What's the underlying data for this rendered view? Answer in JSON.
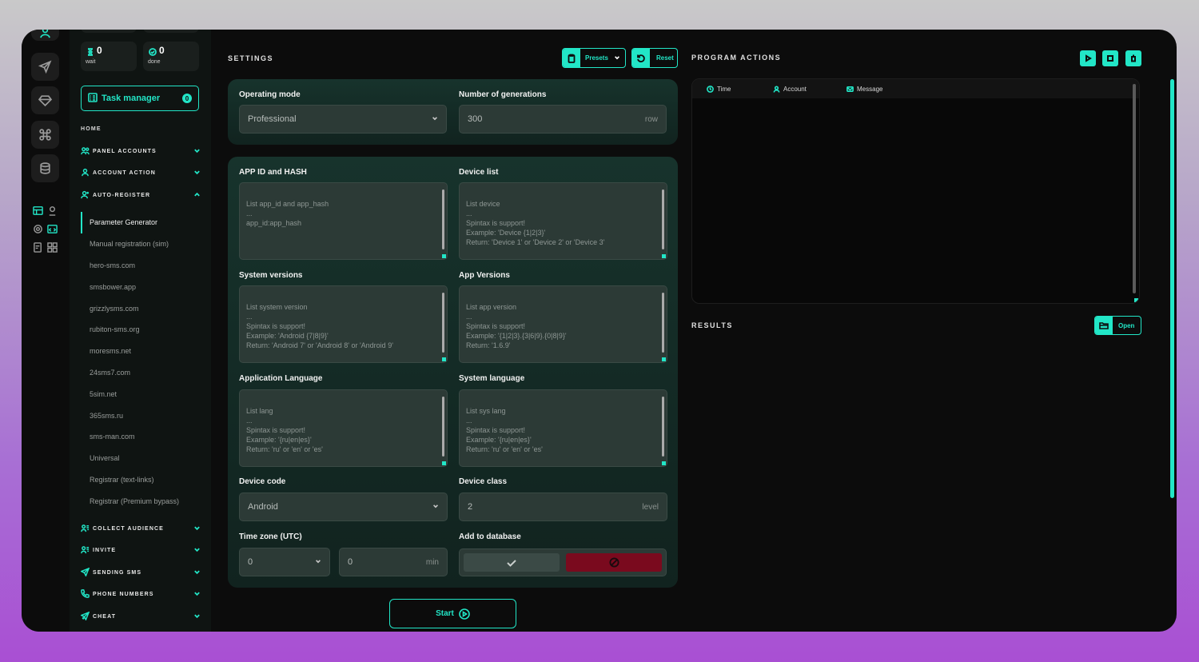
{
  "counters": [
    {
      "value": "0",
      "label": "wait",
      "icon": "hourglass-icon"
    },
    {
      "value": "0",
      "label": "done",
      "icon": "check-circle-icon"
    }
  ],
  "task_manager": {
    "label": "Task manager",
    "badge": "0"
  },
  "sidebar": {
    "home": "HOME",
    "sections_top": [
      {
        "label": "PANEL ACCOUNTS",
        "icon": "users-icon"
      },
      {
        "label": "ACCOUNT ACTION",
        "icon": "user-icon"
      },
      {
        "label": "AUTO-REGISTER",
        "icon": "user-plus-icon"
      }
    ],
    "sub_items": [
      "Parameter Generator",
      "Manual registration (sim)",
      "hero-sms.com",
      "smsbower.app",
      "grizzlysms.com",
      "rubiton-sms.org",
      "moresms.net",
      "24sms7.com",
      "5sim.net",
      "365sms.ru",
      "sms-man.com",
      "Universal",
      "Registrar (text-links)",
      "Registrar (Premium bypass)"
    ],
    "sections_bottom": [
      {
        "label": "COLLECT AUDIENCE",
        "icon": "user-list-icon"
      },
      {
        "label": "INVITE",
        "icon": "user-list-icon"
      },
      {
        "label": "SENDING SMS",
        "icon": "send-icon"
      },
      {
        "label": "PHONE NUMBERS",
        "icon": "phone-icon"
      },
      {
        "label": "CHEAT",
        "icon": "send-plus-icon"
      }
    ]
  },
  "settings": {
    "title": "SETTINGS",
    "presets_label": "Presets",
    "reset_label": "Reset",
    "operating_mode": {
      "label": "Operating mode",
      "value": "Professional"
    },
    "generations": {
      "label": "Number of generations",
      "value": "300",
      "unit": "row"
    },
    "app_id": {
      "label": "APP ID and HASH",
      "placeholder": "List app_id and app_hash\n...\napp_id:app_hash"
    },
    "device_list": {
      "label": "Device list",
      "placeholder": "List device\n...\nSpintax is support!\nExample: 'Device {1|2|3}'\nReturn: 'Device 1' or 'Device 2' or 'Device 3'"
    },
    "system_versions": {
      "label": "System versions",
      "placeholder": "List system version\n...\nSpintax is support!\nExample: 'Android {7|8|9}'\nReturn: 'Android 7' or 'Android 8' or 'Android 9'"
    },
    "app_versions": {
      "label": "App Versions",
      "placeholder": "List app version\n...\nSpintax is support!\nExample: '{1|2|3}.{3|6|9}.{0|8|9}'\nReturn: '1.6.9'"
    },
    "app_language": {
      "label": "Application Language",
      "placeholder": "List lang\n...\nSpintax is support!\nExample: '{ru|en|es}'\nReturn: 'ru' or 'en' or 'es'"
    },
    "system_language": {
      "label": "System language",
      "placeholder": "List sys lang\n...\nSpintax is support!\nExample: '{ru|en|es}'\nReturn: 'ru' or 'en' or 'es'"
    },
    "device_code": {
      "label": "Device code",
      "value": "Android"
    },
    "device_class": {
      "label": "Device class",
      "value": "2",
      "unit": "level"
    },
    "time_zone": {
      "label": "Time zone (UTC)",
      "hours": "0",
      "minutes": "0",
      "unit": "min"
    },
    "add_db": {
      "label": "Add to database"
    },
    "start_label": "Start"
  },
  "program_actions": {
    "title": "PROGRAM ACTIONS",
    "columns": [
      "Time",
      "Account",
      "Message"
    ]
  },
  "results": {
    "title": "RESULTS",
    "open_label": "Open"
  },
  "colors": {
    "accent": "#22e6c7",
    "danger": "#7a0a1e",
    "background": "#0c0c0c"
  }
}
